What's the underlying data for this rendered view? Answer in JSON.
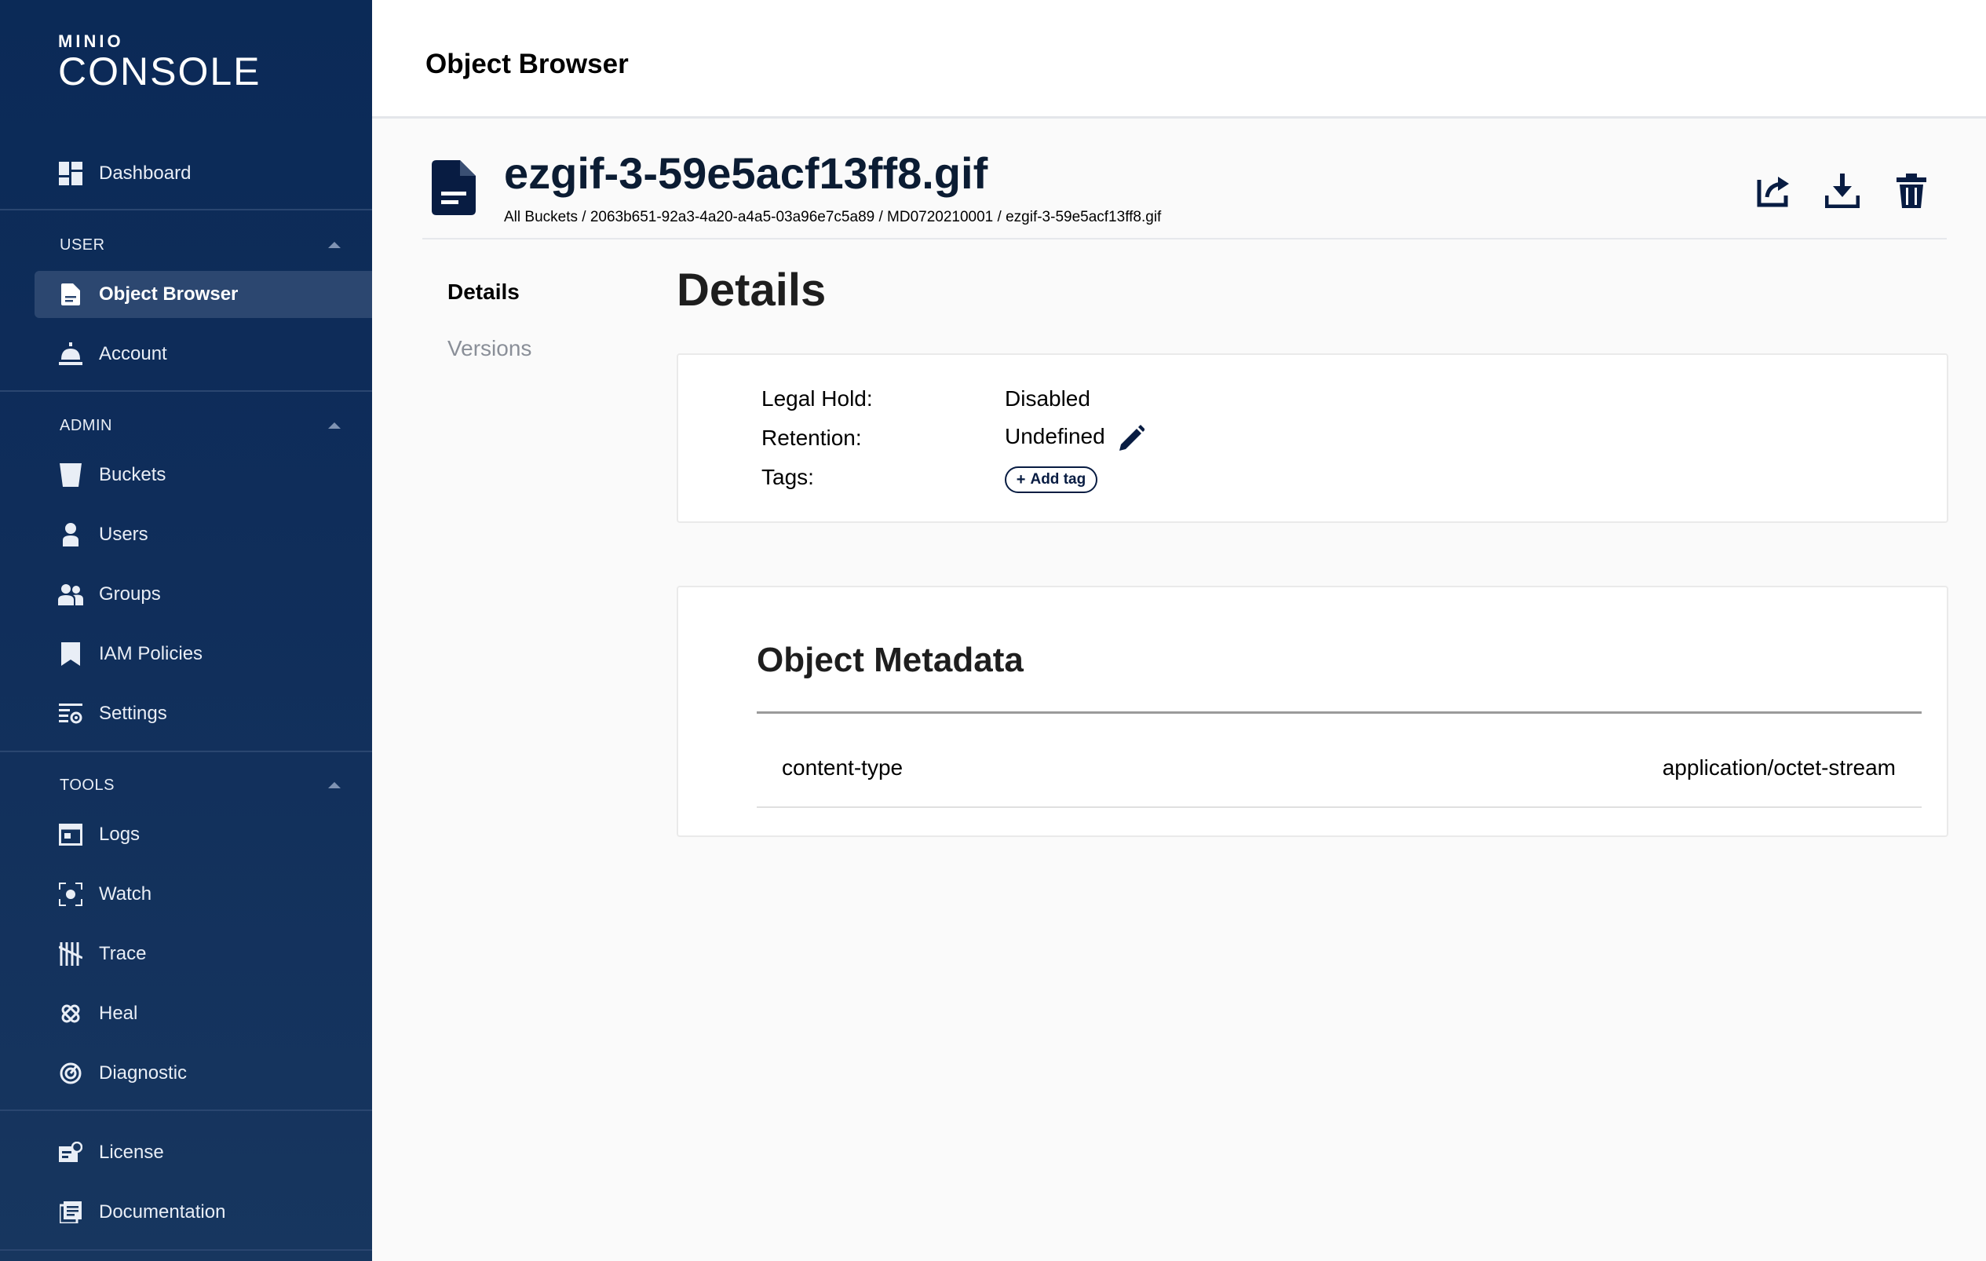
{
  "sidebar": {
    "logo": {
      "brand": "MINIO",
      "product": "CONSOLE"
    },
    "dashboard": "Dashboard",
    "sections": {
      "user": "USER",
      "admin": "ADMIN",
      "tools": "TOOLS"
    },
    "user_items": [
      "Object Browser",
      "Account"
    ],
    "admin_items": [
      "Buckets",
      "Users",
      "Groups",
      "IAM Policies",
      "Settings"
    ],
    "tools_items": [
      "Logs",
      "Watch",
      "Trace",
      "Heal",
      "Diagnostic"
    ],
    "bottom_items": [
      "License",
      "Documentation"
    ]
  },
  "header": {
    "title": "Object Browser"
  },
  "object": {
    "name": "ezgif-3-59e5acf13ff8.gif",
    "path": "All Buckets / 2063b651-92a3-4a20-a4a5-03a96e7c5a89 / MD0720210001 / ezgif-3-59e5acf13ff8.gif"
  },
  "tabs": [
    "Details",
    "Versions"
  ],
  "details": {
    "title": "Details",
    "legal_hold_label": "Legal Hold:",
    "legal_hold_value": "Disabled",
    "retention_label": "Retention:",
    "retention_value": "Undefined",
    "tags_label": "Tags:",
    "add_tag": "Add tag"
  },
  "metadata": {
    "title": "Object Metadata",
    "rows": [
      {
        "key": "content-type",
        "value": "application/octet-stream"
      }
    ]
  },
  "colors": {
    "sidebar": "#0f2d5a",
    "accent": "#081c42",
    "active_item": "#2c4770"
  }
}
